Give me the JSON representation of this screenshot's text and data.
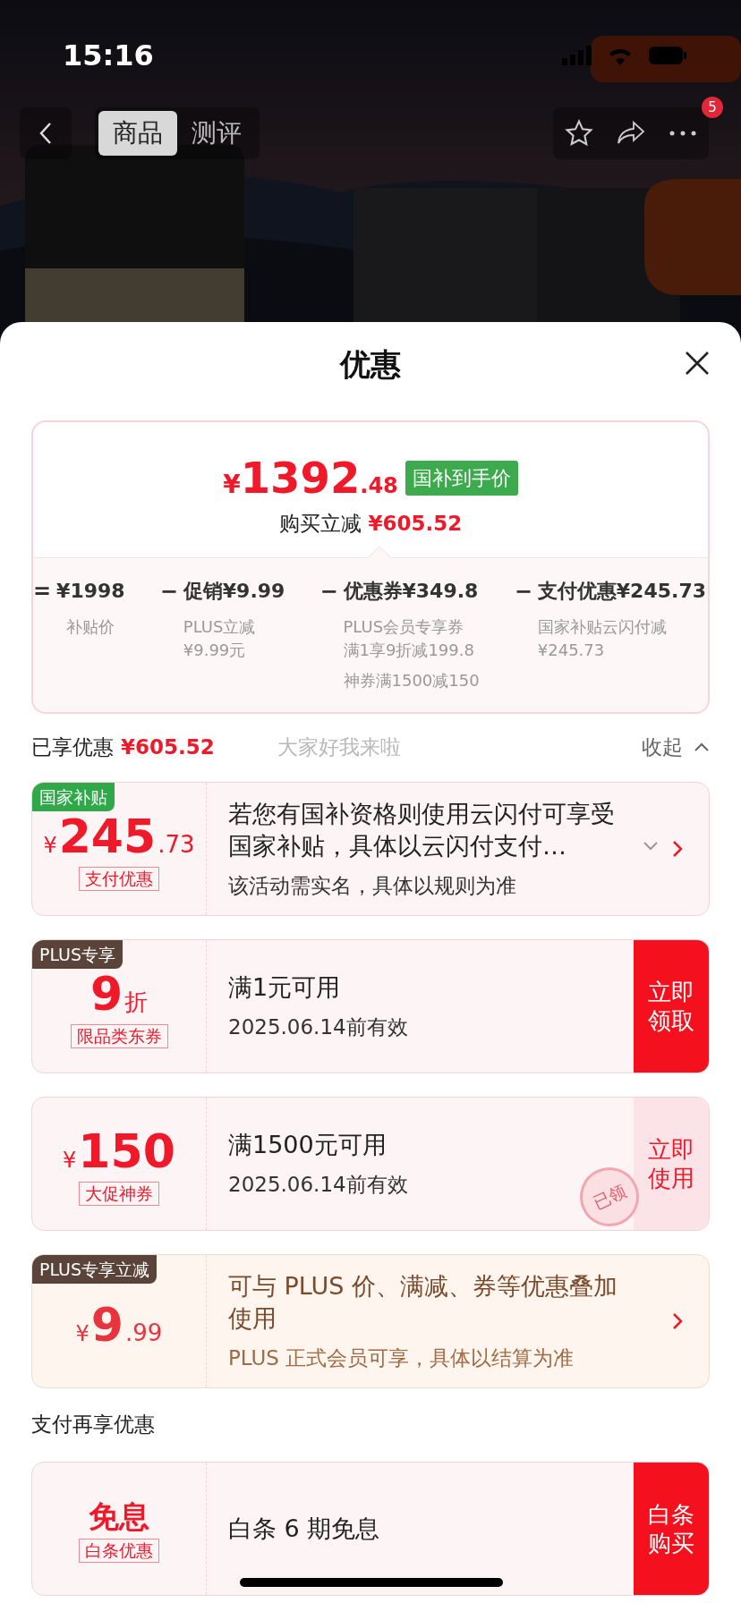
{
  "status_bar": {
    "time": "15:16"
  },
  "nav": {
    "tabs": [
      {
        "label": "商品",
        "selected": true
      },
      {
        "label": "测评",
        "selected": false
      }
    ],
    "more_badge": "5"
  },
  "sheet": {
    "title": "优惠",
    "summary": {
      "price": {
        "prefix": "¥",
        "main": "1392",
        "decimal": ".48"
      },
      "price_tag": "国补到手价",
      "saving_label": "购买立减",
      "saving": "¥605.52",
      "breakdown": [
        {
          "operator": "=",
          "amount": "¥1998",
          "notes": [
            [
              "补贴价"
            ]
          ]
        },
        {
          "operator": "−",
          "amount": "促销¥9.99",
          "notes": [
            [
              "PLUS立减",
              "¥9.99元"
            ]
          ]
        },
        {
          "operator": "−",
          "amount": "优惠券¥349.8",
          "notes": [
            [
              "PLUS会员专享券",
              "满1享9折减199.8"
            ],
            [
              "神券满1500减150"
            ]
          ]
        },
        {
          "operator": "−",
          "amount": "支付优惠¥245.73",
          "notes": [
            [
              "国家补贴云闪付减",
              "¥245.73"
            ]
          ]
        }
      ]
    },
    "enjoyed": {
      "label": "已享优惠",
      "value": "¥605.52",
      "floating_text": "大家好我来啦",
      "collapse": "收起"
    },
    "coupons": [
      {
        "kind": "standard",
        "tag": {
          "text": "国家补贴",
          "kind": "green"
        },
        "amount": {
          "prefix": "¥",
          "main": "245",
          "suffix": ".73"
        },
        "badge": "支付优惠",
        "title": "若您有国补资格则使用云闪付可享受国家补贴，具体以云闪付支付…",
        "expandable": true,
        "subtitle": "该活动需实名，具体以规则为准",
        "action": {
          "kind": "arrow"
        }
      },
      {
        "kind": "standard",
        "tag": {
          "text": "PLUS专享",
          "kind": "brown"
        },
        "amount": {
          "main": "9",
          "suffix": "折"
        },
        "badge": "限品类东券",
        "title": "满1元可用",
        "expandable": false,
        "subtitle": "2025.06.14前有效",
        "action": {
          "kind": "filled",
          "label": "立即领取"
        }
      },
      {
        "kind": "standard",
        "amount": {
          "prefix": "¥",
          "main": "150"
        },
        "badge": "大促神券",
        "title": "满1500元可用",
        "expandable": false,
        "subtitle": "2025.06.14前有效",
        "stamp": "已领",
        "action": {
          "kind": "soft",
          "label": "立即使用"
        }
      },
      {
        "kind": "plus",
        "tag": {
          "text": "PLUS专享立减",
          "kind": "brown"
        },
        "amount": {
          "prefix": "¥",
          "main": "9",
          "suffix": ".99"
        },
        "title": "可与 PLUS 价、满减、券等优惠叠加使用",
        "expandable": false,
        "subtitle": "PLUS 正式会员可享，具体以结算为准",
        "action": {
          "kind": "arrow"
        }
      }
    ],
    "pay_section_title": "支付再享优惠",
    "pay_coupons": [
      {
        "kind": "standard",
        "amount": {
          "main": "免息"
        },
        "badge": "白条优惠",
        "title": "白条 6 期免息",
        "expandable": false,
        "action": {
          "kind": "filled",
          "label": "白条购买"
        }
      }
    ]
  }
}
